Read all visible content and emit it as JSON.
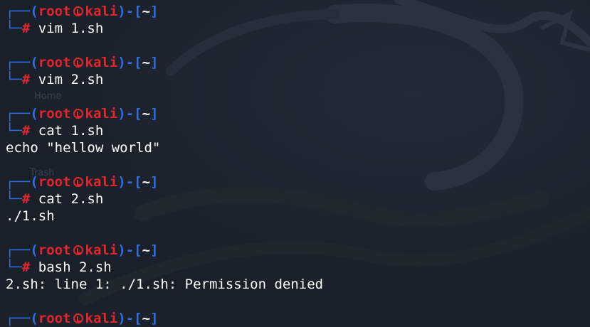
{
  "colors": {
    "background": "#1c222c",
    "prompt_frame": "#2f6fe4",
    "prompt_user": "#e4252b",
    "text": "#ffffff"
  },
  "prompt": {
    "user": "root",
    "host": "kali",
    "dir": "~",
    "symbol": "#",
    "skull_icon": "kali-skull-icon"
  },
  "background_ghost": {
    "home": "Home",
    "trash": "Trash"
  },
  "sessions": [
    {
      "command": "vim 1.sh",
      "output": []
    },
    {
      "command": "vim 2.sh",
      "output": []
    },
    {
      "command": "cat 1.sh",
      "output": [
        "echo \"hellow world\""
      ]
    },
    {
      "command": "cat 2.sh",
      "output": [
        "./1.sh"
      ]
    },
    {
      "command": "bash 2.sh",
      "output": [
        "2.sh: line 1: ./1.sh: Permission denied"
      ]
    }
  ]
}
